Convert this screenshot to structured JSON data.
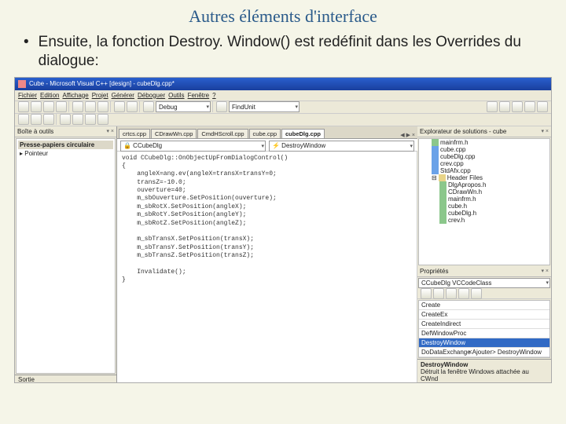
{
  "slide": {
    "title": "Autres éléments d'interface",
    "bullet": "Ensuite, la fonction Destroy. Window() est redéfinit dans les Overrides du dialogue:"
  },
  "titlebar": "Cube - Microsoft Visual C++ [design] - cubeDlg.cpp*",
  "menu": [
    "Fichier",
    "Edition",
    "Affichage",
    "Projet",
    "Générer",
    "Déboguer",
    "Outils",
    "Fenêtre",
    "?"
  ],
  "config": "Debug",
  "find": "FindUnit",
  "toolbox": {
    "title": "Boîte à outils",
    "group": "Presse-papiers circulaire",
    "pointer": "▸ Pointeur"
  },
  "tabs": [
    "crtcs.cpp",
    "CDrawWn.cpp",
    "CmdHScroll.cpp",
    "cube.cpp",
    "cubeDlg.cpp"
  ],
  "activeTab": 4,
  "codeNav": {
    "class": "🔒 CCubeDlg",
    "method": "⚡ DestroyWindow"
  },
  "code": "void CCubeDlg::OnObjectUpFromDialogControl()\n{\n    angleX=ang.ev(angleX=transX=transY=0;\n    transZ=-10.0;\n    ouverture=40;\n    m_sbOuverture.SetPosition(ouverture);\n    m_sbRotX.SetPosition(angleX);\n    m_sbRotY.SetPosition(angleY);\n    m_sbRotZ.SetPosition(angleZ);\n\n    m_sbTransX.SetPosition(transX);\n    m_sbTransY.SetPosition(transY);\n    m_sbTransZ.SetPosition(transZ);\n\n    Invalidate();\n}",
  "solExp": {
    "title": "Explorateur de solutions - cube",
    "items": [
      "mainfrm.h",
      "cube.cpp",
      "cubeDlg.cpp",
      "crev.cpp",
      "StdAfx.cpp"
    ],
    "headerFolder": "Header Files",
    "headers": [
      "DlgApropos.h",
      "CDrawWn.h",
      "mainfrm.h",
      "cube.h",
      "cubeDlg.h",
      "crev.h"
    ]
  },
  "props": {
    "title": "Propriétés",
    "object": "CCubeDlg  VCCodeClass",
    "rows": [
      "Create",
      "CreateEx",
      "CreateIndirect",
      "DefWindowProc"
    ],
    "selected": "DestroyWindow",
    "afterSel": "DoDataExchange",
    "afterSelVal": "<Ajouter> DestroyWindow",
    "footName": "DestroyWindow",
    "footDesc": "Détruit la fenêtre Windows attachée au CWnd"
  },
  "sortie": "Sortie"
}
